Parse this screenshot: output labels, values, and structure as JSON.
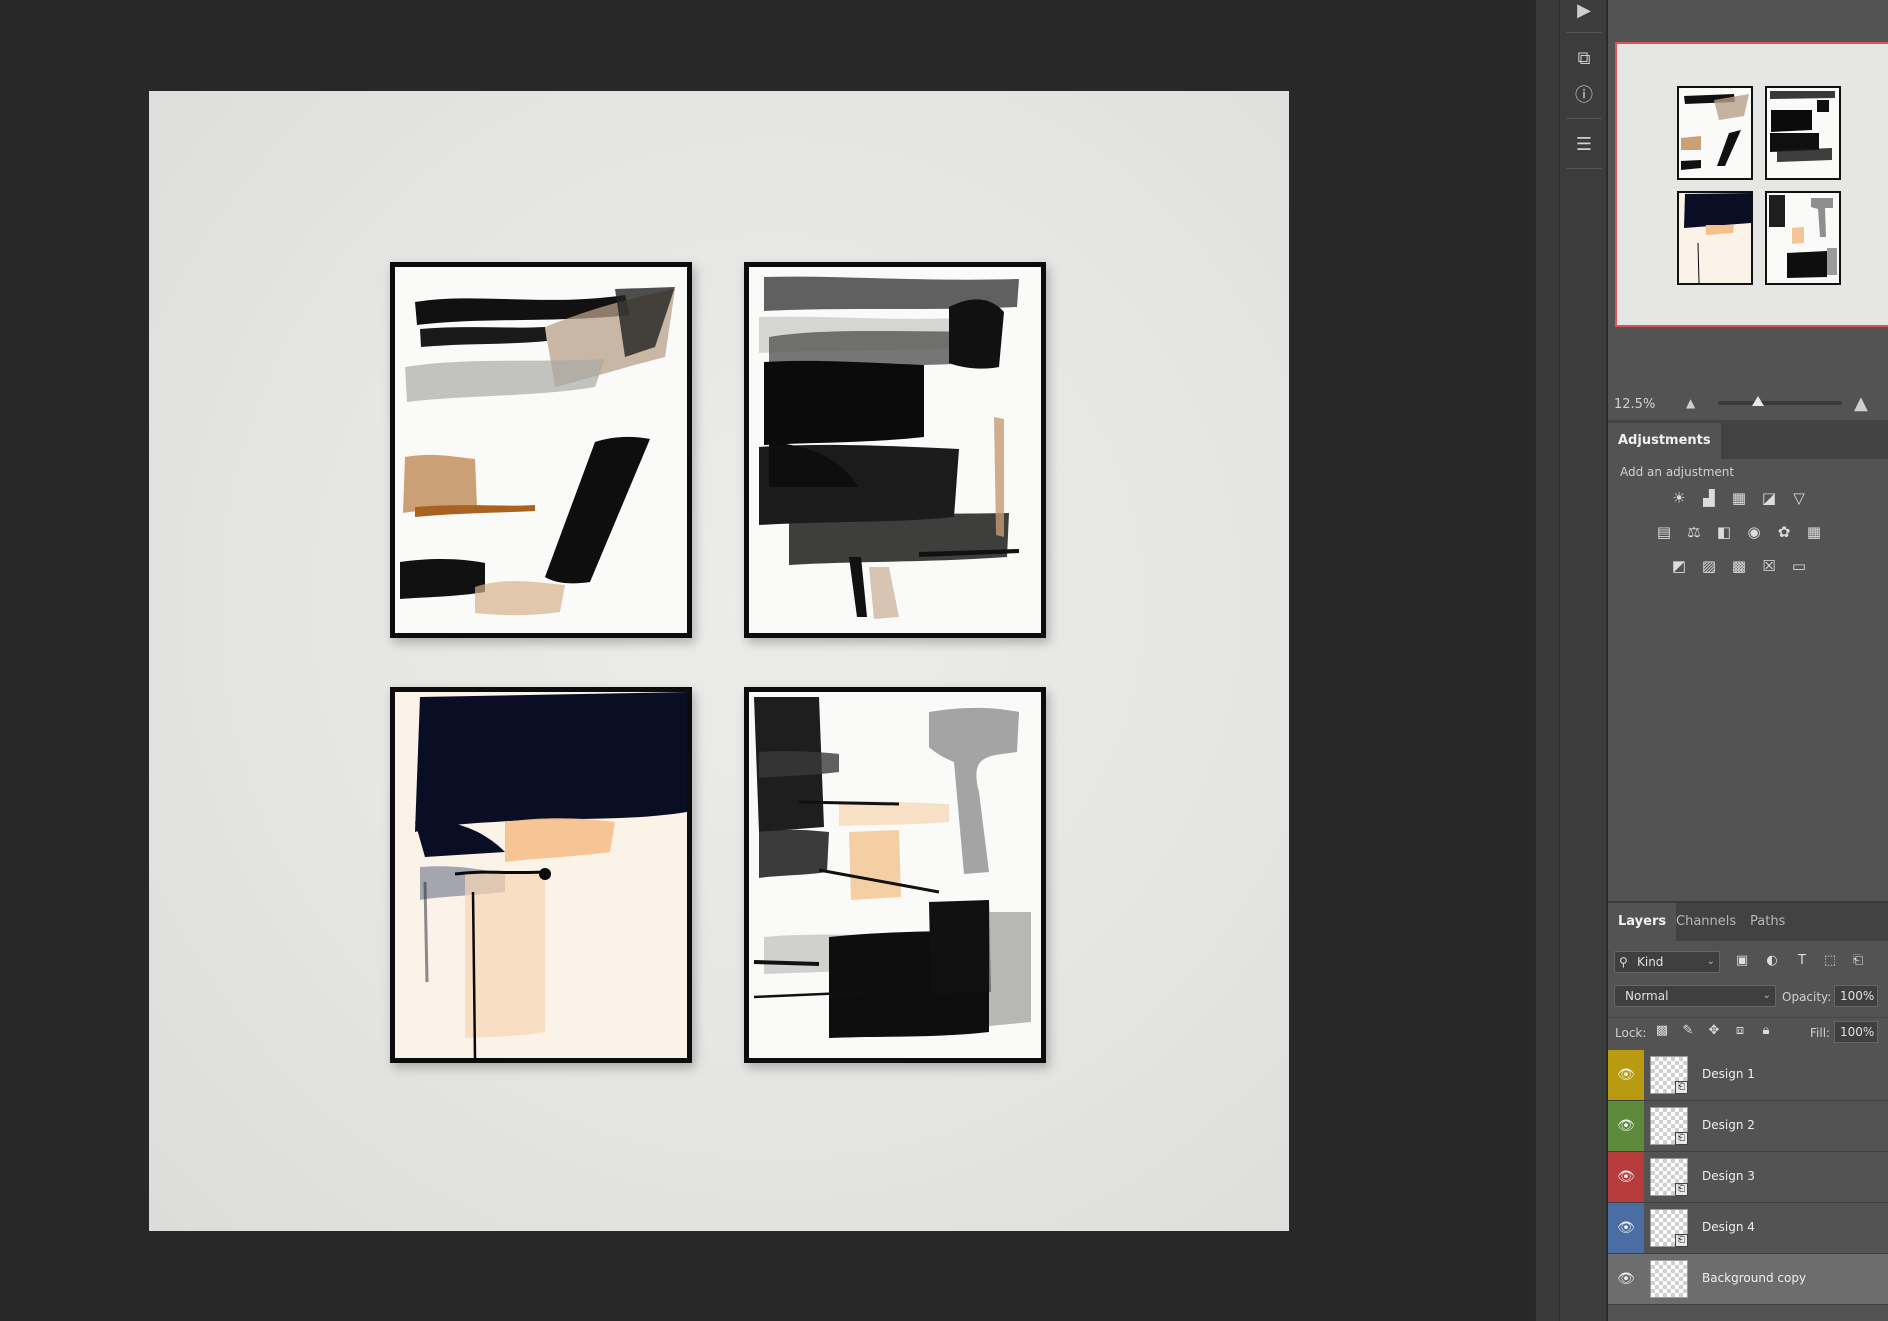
{
  "canvas": {
    "frames": [
      "design-1",
      "design-2",
      "design-3",
      "design-4"
    ]
  },
  "navigator": {
    "zoom": "12.5%",
    "zoom_slider_position": 0.32,
    "highlight_color": "#e0525a"
  },
  "adjustments": {
    "tab_label": "Adjustments",
    "subtitle": "Add an adjustment",
    "icons_row1": [
      "brightness-contrast-icon",
      "levels-icon",
      "curves-icon",
      "exposure-icon",
      "vibrance-icon"
    ],
    "icons_row2": [
      "hue-saturation-icon",
      "color-balance-icon",
      "black-white-icon",
      "photo-filter-icon",
      "channel-mixer-icon",
      "color-lookup-icon"
    ],
    "icons_row3": [
      "invert-icon",
      "posterize-icon",
      "threshold-icon",
      "selective-color-icon",
      "gradient-map-icon"
    ]
  },
  "layers_panel": {
    "tabs": [
      "Layers",
      "Channels",
      "Paths"
    ],
    "active_tab": "Layers",
    "filter_kind": "Kind",
    "blend_mode": "Normal",
    "opacity_label": "Opacity:",
    "opacity": "100%",
    "lock_label": "Lock:",
    "fill_label": "Fill:",
    "fill": "100%",
    "layers": [
      {
        "name": "Design 1",
        "color": "#b89b10",
        "selected": false
      },
      {
        "name": "Design 2",
        "color": "#5e8a3c",
        "selected": false
      },
      {
        "name": "Design 3",
        "color": "#b63c3c",
        "selected": false
      },
      {
        "name": "Design 4",
        "color": "#4a6da3",
        "selected": false
      },
      {
        "name": "Background copy",
        "color": "",
        "selected": true
      }
    ]
  }
}
